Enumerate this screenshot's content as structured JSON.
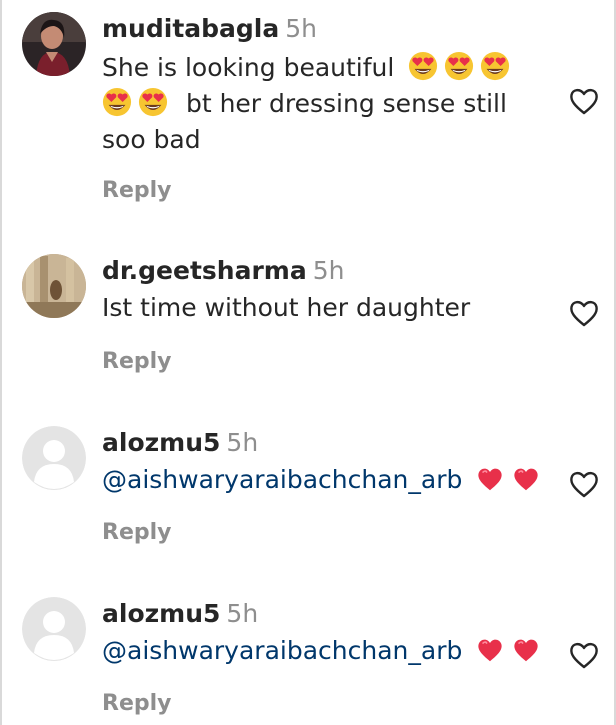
{
  "comments": [
    {
      "username": "muditabagla",
      "time": "5h",
      "text_line1": "She is looking beautiful",
      "text_line2": "bt her dressing sense still",
      "text_line3": "soo bad",
      "reply_label": "Reply"
    },
    {
      "username": "dr.geetsharma",
      "time": "5h",
      "text": "Ist time without her daughter",
      "reply_label": "Reply"
    },
    {
      "username": "alozmu5",
      "time": "5h",
      "mention": "@aishwaryaraibachchan_arb",
      "reply_label": "Reply"
    },
    {
      "username": "alozmu5",
      "time": "5h",
      "mention": "@aishwaryaraibachchan_arb",
      "reply_label": "Reply"
    }
  ],
  "icons": {
    "like": "heart-outline-icon",
    "emoji_heart_eyes": "smiling-face-with-heart-eyes",
    "emoji_red_heart": "red-heart"
  },
  "colors": {
    "mention": "#00376b",
    "secondary_text": "#8e8e8e",
    "emoji_face": "#f7c531",
    "emoji_heart": "#e8304a"
  }
}
